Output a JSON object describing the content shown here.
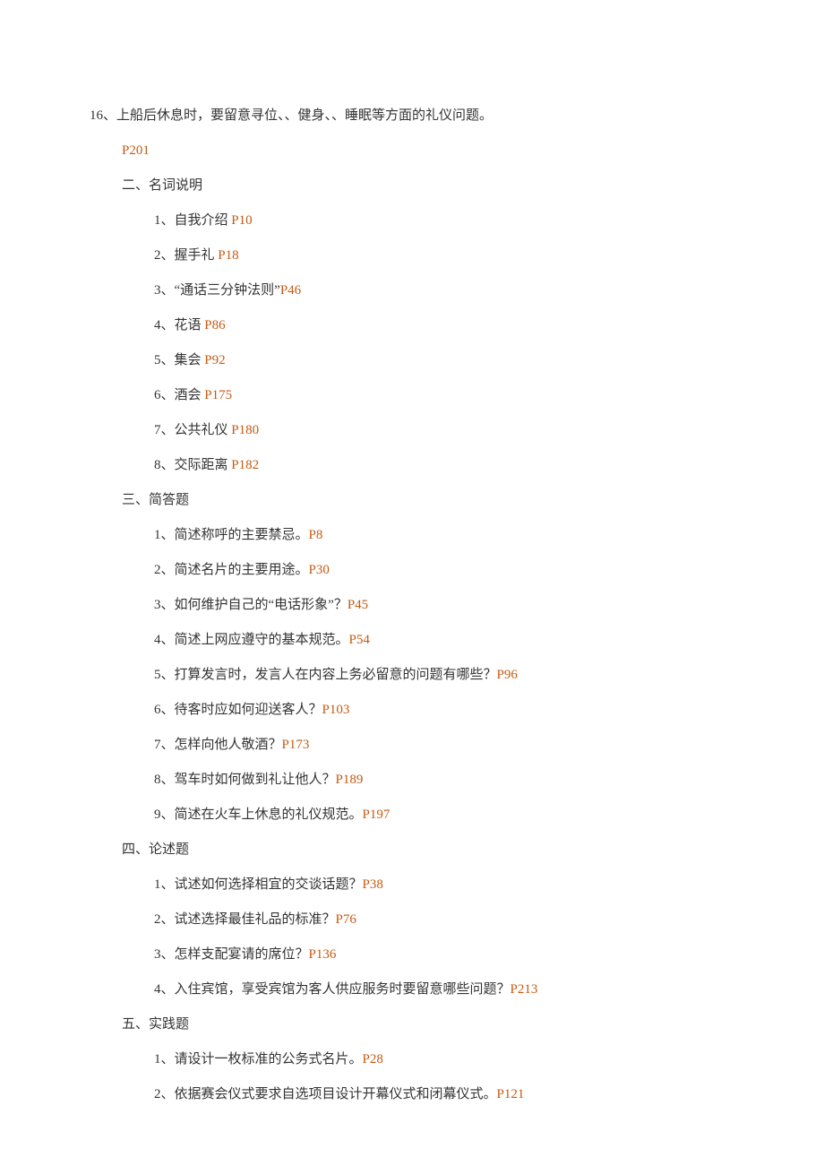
{
  "lines": [
    {
      "indent": 0,
      "text": "16、上船后休息时，要留意寻位、、健身、、睡眠等方面的礼仪问题。",
      "ref": ""
    },
    {
      "indent": 1,
      "text": "",
      "ref": "P201"
    },
    {
      "indent": 1,
      "text": "二、名词说明",
      "ref": ""
    },
    {
      "indent": 2,
      "text": "1、自我介绍 ",
      "ref": "P10"
    },
    {
      "indent": 2,
      "text": "2、握手礼 ",
      "ref": "P18"
    },
    {
      "indent": 2,
      "text": "3、“通话三分钟法则”",
      "ref": "P46"
    },
    {
      "indent": 2,
      "text": "4、花语 ",
      "ref": "P86"
    },
    {
      "indent": 2,
      "text": "5、集会 ",
      "ref": "P92"
    },
    {
      "indent": 2,
      "text": "6、酒会 ",
      "ref": "P175"
    },
    {
      "indent": 2,
      "text": "7、公共礼仪 ",
      "ref": "P180"
    },
    {
      "indent": 2,
      "text": "8、交际距离 ",
      "ref": "P182"
    },
    {
      "indent": 1,
      "text": "三、简答题",
      "ref": ""
    },
    {
      "indent": 2,
      "text": "1、简述称呼的主要禁忌。",
      "ref": "P8"
    },
    {
      "indent": 2,
      "text": "2、简述名片的主要用途。",
      "ref": "P30"
    },
    {
      "indent": 2,
      "text": "3、如何维护自己的“电话形象”？",
      "ref": "P45"
    },
    {
      "indent": 2,
      "text": "4、简述上网应遵守的基本规范。",
      "ref": "P54"
    },
    {
      "indent": 2,
      "text": "5、打算发言时，发言人在内容上务必留意的问题有哪些？",
      "ref": "P96"
    },
    {
      "indent": 2,
      "text": "6、待客时应如何迎送客人？",
      "ref": "P103"
    },
    {
      "indent": 2,
      "text": "7、怎样向他人敬酒？",
      "ref": "P173"
    },
    {
      "indent": 2,
      "text": "8、驾车时如何做到礼让他人？",
      "ref": "P189"
    },
    {
      "indent": 2,
      "text": "9、简述在火车上休息的礼仪规范。",
      "ref": "P197"
    },
    {
      "indent": 1,
      "text": "四、论述题",
      "ref": ""
    },
    {
      "indent": 2,
      "text": "1、试述如何选择相宜的交谈话题？",
      "ref": "P38"
    },
    {
      "indent": 2,
      "text": "2、试述选择最佳礼品的标准？",
      "ref": "P76"
    },
    {
      "indent": 2,
      "text": "3、怎样支配宴请的席位？",
      "ref": "P136"
    },
    {
      "indent": 2,
      "text": "4、入住宾馆，享受宾馆为客人供应服务时要留意哪些问题？",
      "ref": "P213"
    },
    {
      "indent": 1,
      "text": "五、实践题",
      "ref": ""
    },
    {
      "indent": 2,
      "text": "1、请设计一枚标准的公务式名片。",
      "ref": "P28"
    },
    {
      "indent": 2,
      "text": "2、依据赛会仪式要求自选项目设计开幕仪式和闭幕仪式。",
      "ref": "P121"
    }
  ]
}
